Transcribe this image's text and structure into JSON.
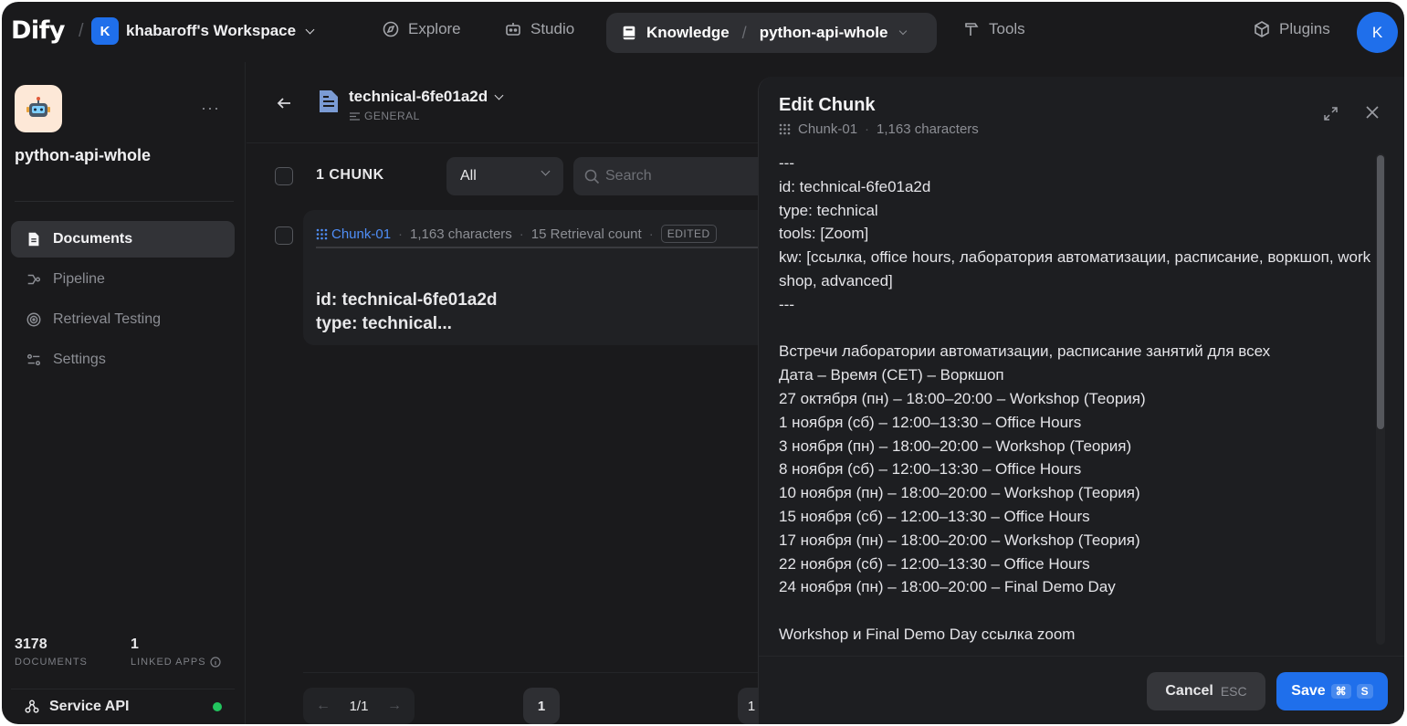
{
  "topbar": {
    "logo": "Dify",
    "workspace_badge": "K",
    "workspace_name": "khabaroff's Workspace",
    "nav": {
      "explore": "Explore",
      "studio": "Studio",
      "knowledge": "Knowledge",
      "dataset": "python-api-whole",
      "tools": "Tools",
      "plugins": "Plugins"
    },
    "avatar": "K",
    "accent": "#1f6feb"
  },
  "sidebar": {
    "dataset_title": "python-api-whole",
    "items": [
      {
        "label": "Documents",
        "icon": "document-icon",
        "active": true
      },
      {
        "label": "Pipeline",
        "icon": "pipeline-icon",
        "active": false
      },
      {
        "label": "Retrieval Testing",
        "icon": "target-icon",
        "active": false
      },
      {
        "label": "Settings",
        "icon": "settings-icon",
        "active": false
      }
    ],
    "stats": {
      "documents_num": "3178",
      "documents_label": "DOCUMENTS",
      "apps_num": "1",
      "apps_label": "LINKED APPS"
    },
    "service_api": "Service API",
    "status_color": "#22c55e"
  },
  "main": {
    "doc_name": "technical-6fe01a2d",
    "doc_tag": "GENERAL",
    "chunk_count": "1 CHUNK",
    "filter_value": "All",
    "search_placeholder": "Search",
    "chunk": {
      "id": "Chunk-01",
      "chars": "1,163 characters",
      "retrieval": "15 Retrieval count",
      "badge": "EDITED",
      "preview_line1": "id: technical-6fe01a2d",
      "preview_line2": "type: technical..."
    },
    "pager": {
      "current": "1/1",
      "page": "1",
      "page2": "1"
    }
  },
  "panel": {
    "title": "Edit Chunk",
    "chunk_id": "Chunk-01",
    "chars": "1,163 characters",
    "content": [
      "---",
      "id: technical-6fe01a2d",
      "type: technical",
      "tools: [Zoom]",
      "kw: [ссылка, office hours, лаборатория автоматизации, расписание, воркшоп, workshop, advanced]",
      "---",
      "",
      "Встречи лаборатории автоматизации, расписание занятий для всех",
      "Дата – Время (CET) – Воркшоп",
      "27 октября (пн) – 18:00–20:00 – Workshop (Теория)",
      "1 ноября (сб) – 12:00–13:30 – Office Hours",
      "3 ноября (пн) – 18:00–20:00 – Workshop (Теория)",
      "8 ноября (сб) – 12:00–13:30 – Office Hours",
      "10 ноября (пн) – 18:00–20:00 – Workshop (Теория)",
      "15 ноября (сб) – 12:00–13:30 – Office Hours",
      "17 ноября (пн) – 18:00–20:00 – Workshop (Теория)",
      "22 ноября (сб) – 12:00–13:30 – Office Hours",
      "24 ноября (пн) – 18:00–20:00 – Final Demo Day",
      "",
      "Workshop и Final Demo Day ссылка zoom"
    ],
    "cancel_label": "Cancel",
    "cancel_kbd": "ESC",
    "save_label": "Save",
    "save_kbd1": "⌘",
    "save_kbd2": "S"
  }
}
